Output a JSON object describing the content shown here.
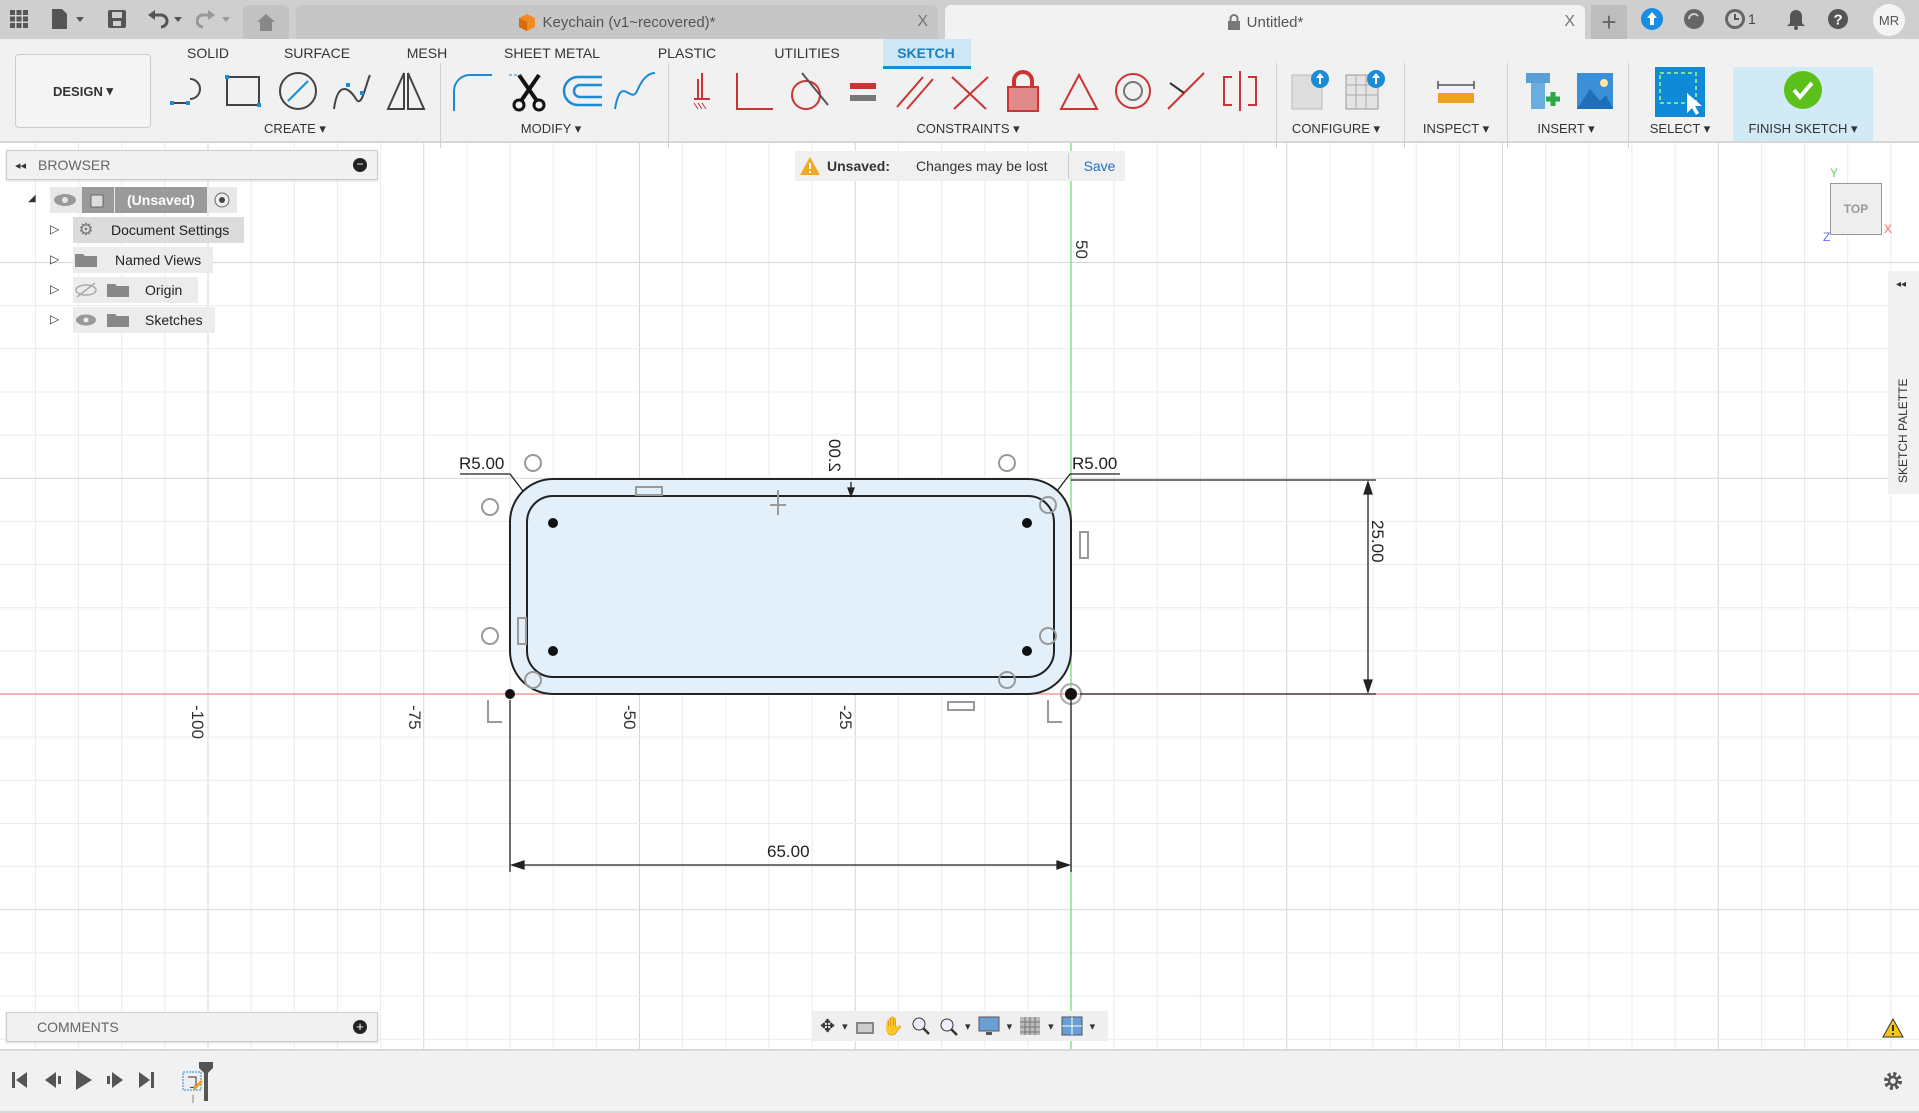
{
  "tabs": {
    "home": "home-icon",
    "inactive": {
      "title": "Keychain (v1~recovered)*"
    },
    "active": {
      "title": "Untitled*"
    },
    "close": "X",
    "notification_count": "1",
    "user_initials": "MR"
  },
  "toolbar": {
    "workspace": "DESIGN",
    "tabs": [
      "SOLID",
      "SURFACE",
      "MESH",
      "SHEET METAL",
      "PLASTIC",
      "UTILITIES",
      "SKETCH"
    ],
    "active_tab": "SKETCH",
    "groups": {
      "create": "CREATE",
      "modify": "MODIFY",
      "constraints": "CONSTRAINTS",
      "configure": "CONFIGURE",
      "inspect": "INSPECT",
      "insert": "INSERT",
      "select": "SELECT",
      "finish": "FINISH SKETCH"
    }
  },
  "browser": {
    "title": "BROWSER",
    "root": "(Unsaved)",
    "items": [
      "Document Settings",
      "Named Views",
      "Origin",
      "Sketches"
    ]
  },
  "banner": {
    "label": "Unsaved:",
    "message": "Changes may be lost",
    "action": "Save"
  },
  "canvas": {
    "axis_labels": {
      "x": [
        "-100",
        "-75",
        "-50",
        "-25"
      ],
      "y": [
        "50"
      ]
    },
    "dimensions": {
      "radius_left": "R5.00",
      "radius_right": "R5.00",
      "offset": "2.00",
      "height": "25.00",
      "width": "65.00"
    },
    "viewcube": {
      "face": "TOP",
      "x": "X",
      "y": "Y",
      "z": "Z"
    },
    "colors": {
      "x_axis": "#e06666",
      "y_axis": "#66cc66",
      "profile_fill": "#e3f0fa"
    }
  },
  "sketch_palette": {
    "title": "SKETCH PALETTE"
  },
  "comments": {
    "title": "COMMENTS"
  }
}
